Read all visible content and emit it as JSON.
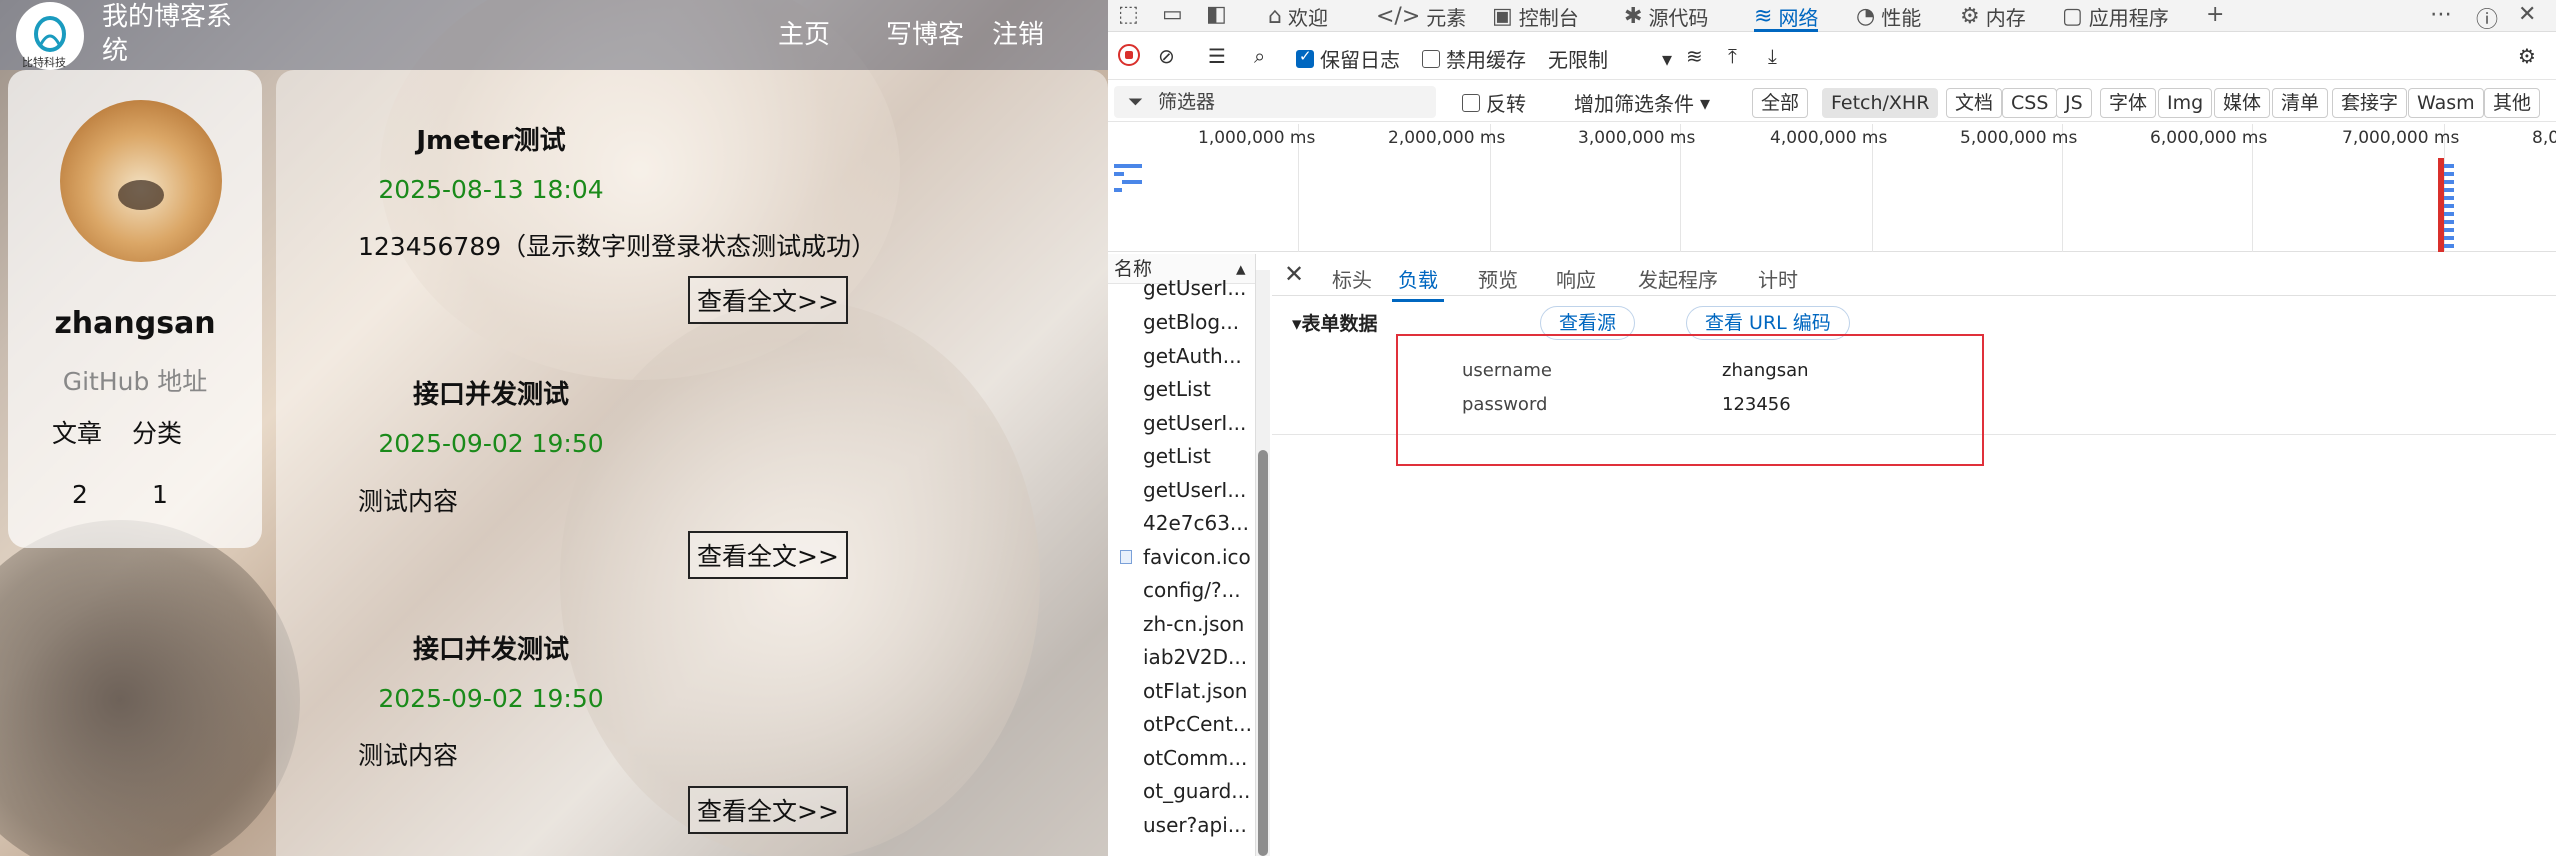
{
  "blog": {
    "logo_text": "比特科技",
    "site_title": "我的博客系统",
    "nav": {
      "home": "主页",
      "write": "写博客",
      "logout": "注销"
    },
    "profile": {
      "username": "zhangsan",
      "github": "GitHub 地址",
      "stats_labels": [
        "文章",
        "分类"
      ],
      "stats_values": [
        "2",
        "1"
      ]
    },
    "posts": [
      {
        "title": "Jmeter测试",
        "date": "2025-08-13 18:04",
        "body": "123456789（显示数字则登录状态测试成功）",
        "read_more": "查看全文>>"
      },
      {
        "title": "接口并发测试",
        "date": "2025-09-02 19:50",
        "body": "测试内容",
        "read_more": "查看全文>>"
      },
      {
        "title": "接口并发测试",
        "date": "2025-09-02 19:50",
        "body": "测试内容",
        "read_more": "查看全文>>"
      }
    ]
  },
  "devtools": {
    "tabs": [
      {
        "icon": "home-icon",
        "label": "欢迎"
      },
      {
        "icon": "code-icon",
        "label": "元素"
      },
      {
        "icon": "console-icon",
        "label": "控制台"
      },
      {
        "icon": "bug-icon",
        "label": "源代码"
      },
      {
        "icon": "wifi-icon",
        "label": "网络"
      },
      {
        "icon": "performance-icon",
        "label": "性能"
      },
      {
        "icon": "memory-icon",
        "label": "内存"
      },
      {
        "icon": "application-icon",
        "label": "应用程序"
      }
    ],
    "toolbar": {
      "preserve_log": "保留日志",
      "disable_cache": "禁用缓存",
      "throttle": "无限制"
    },
    "filter": {
      "placeholder": "筛选器",
      "invert": "反转",
      "more_filters": "增加筛选条件",
      "chips": [
        "全部",
        "Fetch/XHR",
        "文档",
        "CSS",
        "JS",
        "字体",
        "Img",
        "媒体",
        "清单",
        "套接字",
        "Wasm",
        "其他"
      ]
    },
    "timeline_ticks": [
      "1,000,000 ms",
      "2,000,000 ms",
      "3,000,000 ms",
      "4,000,000 ms",
      "5,000,000 ms",
      "6,000,000 ms",
      "7,000,000 ms",
      "8,0"
    ],
    "names_header": "名称",
    "requests": [
      "getUserI...",
      "getBlog...",
      "getAuth...",
      "getList",
      "getUserI...",
      "getList",
      "getUserI...",
      "42e7c63...",
      "favicon.ico",
      "config/?...",
      "zh-cn.json",
      "iab2V2D...",
      "otFlat.json",
      "otPcCent...",
      "otComm...",
      "ot_guard...",
      "user?api..."
    ],
    "detail_tabs": [
      "标头",
      "负载",
      "预览",
      "响应",
      "发起程序",
      "计时"
    ],
    "form": {
      "header": "表单数据",
      "view_source": "查看源",
      "view_url_encoded": "查看 URL 编码",
      "rows": [
        {
          "key": "username",
          "value": "zhangsan"
        },
        {
          "key": "password",
          "value": "123456"
        }
      ]
    }
  }
}
